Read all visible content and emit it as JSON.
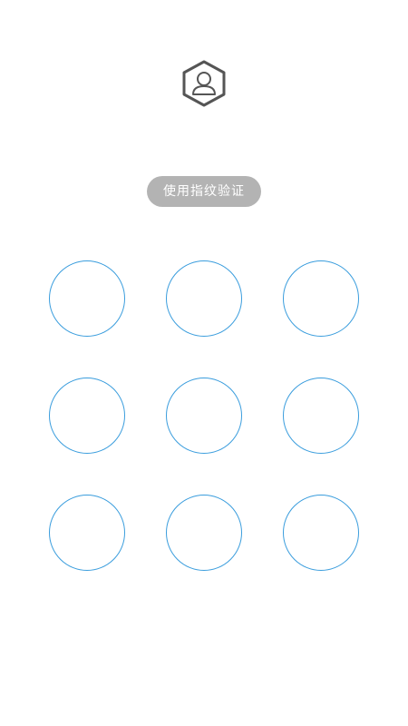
{
  "header": {
    "avatar_icon": "user-hexagon-icon"
  },
  "fingerprint": {
    "label": "使用指纹验证"
  },
  "pattern": {
    "rows": 3,
    "cols": 3,
    "dot_color": "#3a9ddd"
  },
  "colors": {
    "background": "#ffffff",
    "button_bg": "#b3b3b3",
    "icon": "#555555"
  }
}
